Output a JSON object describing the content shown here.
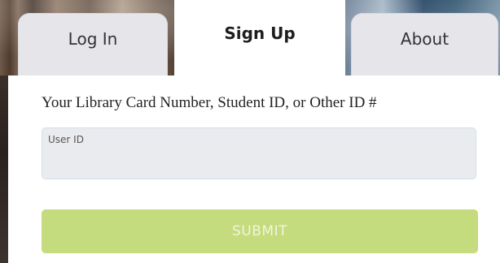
{
  "tabs": {
    "login": "Log In",
    "signup": "Sign Up",
    "about": "About",
    "active": "Sign Up"
  },
  "form": {
    "label": "Your Library Card Number, Student ID, or Other ID #",
    "user_id": {
      "label": "User ID",
      "value": ""
    },
    "submit_label": "SUBMIT",
    "submit_enabled": false
  },
  "colors": {
    "submit_background": "#c4dc7e",
    "submit_text": "#eef6db",
    "inactive_tab": "#e6e6ea",
    "input_background": "#e9ebee",
    "input_border": "#cfdfee"
  }
}
